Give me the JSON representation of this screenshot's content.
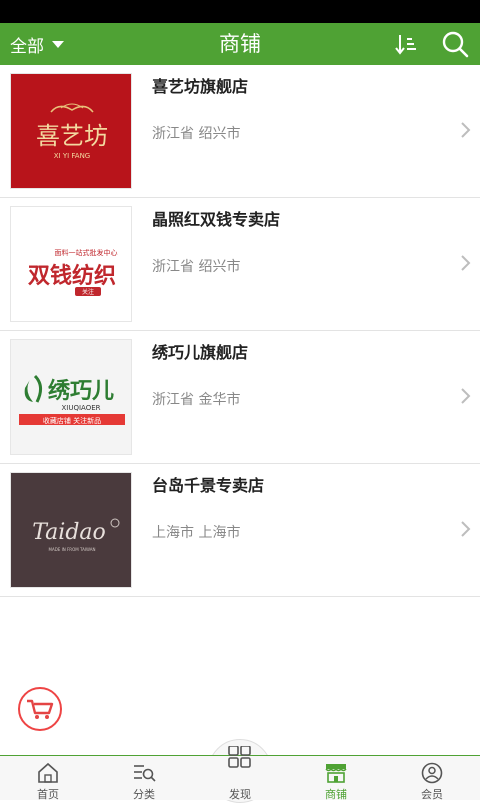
{
  "header": {
    "filter_label": "全部",
    "title": "商铺"
  },
  "shops": [
    {
      "name": "喜艺坊旗舰店",
      "location": "浙江省 绍兴市",
      "logo_main": "喜艺坊",
      "logo_sub": "XI YI FANG"
    },
    {
      "name": "晶照红双钱专卖店",
      "location": "浙江省 绍兴市",
      "logo_main": "双钱纺织",
      "logo_sub": "面料一站式批发中心",
      "logo_badge": "关注"
    },
    {
      "name": "绣巧儿旗舰店",
      "location": "浙江省 金华市",
      "logo_main": "绣巧儿",
      "logo_sub": "XIUQIAOER",
      "logo_banner": "收藏店铺 关注新品"
    },
    {
      "name": "台岛千景专卖店",
      "location": "上海市 上海市",
      "logo_main": "Taidao",
      "logo_sub": "MADE IN FROM TAIWAN"
    }
  ],
  "tabs": [
    {
      "label": "首页",
      "icon": "home-icon"
    },
    {
      "label": "分类",
      "icon": "category-icon"
    },
    {
      "label": "发现",
      "icon": "discover-grid-icon"
    },
    {
      "label": "商铺",
      "icon": "shop-icon"
    },
    {
      "label": "会员",
      "icon": "member-icon"
    }
  ],
  "colors": {
    "brand_green": "#4fa234",
    "cart_red": "#e44444"
  },
  "floating": {
    "icon": "cart-icon"
  }
}
